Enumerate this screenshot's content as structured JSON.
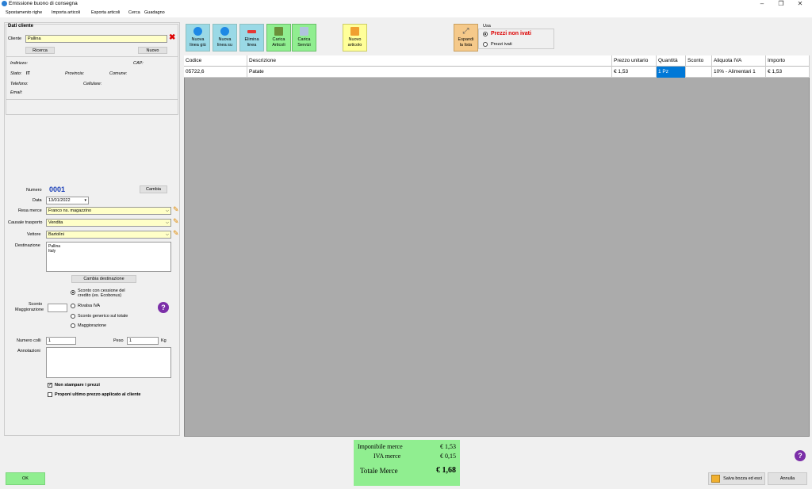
{
  "window": {
    "title": "Emissione buono di consegna",
    "minimize": "–",
    "restore": "❐",
    "close": "✕"
  },
  "menu": [
    "Spostamento righe",
    "Importa articoli",
    "Esporta articoli",
    "Cerca",
    "Guadagno"
  ],
  "cliente": {
    "section_title": "Dati cliente",
    "label": "Cliente",
    "value": "Pallina",
    "search_button": "Ricerca",
    "new_button": "Nuovo",
    "indirizzo": "Indirizzo:",
    "cap": "CAP:",
    "stato_label": "Stato:",
    "stato_value": "IT",
    "provincia": "Provincia:",
    "comune": "Comune:",
    "telefono": "Telefono:",
    "cellulare": "Cellulare:",
    "email": "Email:"
  },
  "document": {
    "numero_label": "Numero",
    "numero_value": "0001",
    "cambia_button": "Cambia",
    "data_label": "Data",
    "data_value": "13/01/2022",
    "resa_label": "Resa merce",
    "resa_value": "Franco ns. magazzino",
    "causale_label": "Causale trasporto",
    "causale_value": "Vendita",
    "vettore_label": "Vettore",
    "vettore_value": "Bartolini",
    "destinazione_label": "Destinazione",
    "destinazione_line1": "Pallina",
    "destinazione_line2": "Italy",
    "cambia_destinazione": "Cambia destinazione",
    "sconto_label1": "Sconto",
    "sconto_label2": "Maggiorazione",
    "opt_ecobonus1": "Sconto con cessione del",
    "opt_ecobonus2": "credito (es. Ecobonus)",
    "opt_rivalsa": "Rivalsa IVA",
    "opt_sconto_totale": "Sconto generico sul totale",
    "opt_maggiorazione": "Maggiorazione",
    "colli_label": "Numero colli",
    "colli_value": "1",
    "peso_label": "Peso",
    "peso_value": "1",
    "peso_unit": "Kg",
    "annotazioni_label": "Annotazioni",
    "non_stampare": "Non stampare i prezzi",
    "proponi": "Proponi ultimo prezzo applicato al cliente"
  },
  "toolbar": {
    "nuova_giu": [
      "Nuova",
      "linea giù"
    ],
    "nuova_su": [
      "Nuova",
      "linea su"
    ],
    "elimina": [
      "Elimina",
      "linea"
    ],
    "carica_articoli": [
      "Carica",
      "Articoli"
    ],
    "carica_servizi": [
      "Carica",
      "Servizi"
    ],
    "nuovo_articolo": [
      "Nuovo",
      "articolo"
    ],
    "espandi": [
      "Espandi",
      "la lista"
    ],
    "usa_label": "Usa",
    "prezzi_non_ivati": "Prezzi non ivati",
    "prezzi_ivati": "Prezzi ivati"
  },
  "grid": {
    "columns": [
      "Codice",
      "Descrizione",
      "Prezzo unitario",
      "Quantità",
      "Sconto",
      "Aliquota IVA",
      "Importo"
    ],
    "rows": [
      [
        "05722,6",
        "Patate",
        "€ 1,53",
        "1 Pz",
        "",
        "10% - Alimentari 1",
        "€ 1,53"
      ]
    ]
  },
  "totals": {
    "imponibile_label": "Imponibile merce",
    "imponibile_value": "€ 1,53",
    "iva_label": "IVA merce",
    "iva_value": "€ 0,15",
    "totale_label": "Totale Merce",
    "totale_value": "€ 1,68"
  },
  "footer": {
    "ok": "OK",
    "salva": "Salva bozza ed esci",
    "annulla": "Annulla"
  },
  "colors": {
    "accent_green": "#90ee90",
    "field_yellow": "#ffffc8",
    "selected_blue": "#0078d7",
    "help_purple": "#7b2fa8"
  }
}
